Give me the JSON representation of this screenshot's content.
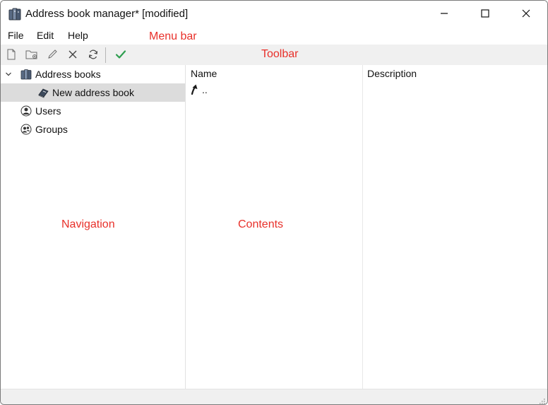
{
  "window": {
    "title": "Address book manager* [modified]",
    "icons": {
      "app": "address-books-icon",
      "minimize": "minimize-icon",
      "maximize": "maximize-icon",
      "close": "close-icon"
    }
  },
  "menubar": {
    "items": [
      {
        "label": "File"
      },
      {
        "label": "Edit"
      },
      {
        "label": "Help"
      }
    ]
  },
  "toolbar": {
    "buttons": [
      {
        "icon": "new-file-icon"
      },
      {
        "icon": "new-folder-icon"
      },
      {
        "icon": "edit-pencil-icon"
      },
      {
        "icon": "delete-x-icon"
      },
      {
        "icon": "refresh-icon"
      },
      {
        "icon": "apply-check-icon",
        "color": "#2e9e4f"
      }
    ]
  },
  "overlays": {
    "menubar": "Menu bar",
    "toolbar": "Toolbar",
    "navigation": "Navigation",
    "contents": "Contents"
  },
  "navigation": {
    "tree": [
      {
        "label": "Address books",
        "icon": "address-books-icon",
        "expanded": true
      },
      {
        "label": "New address book",
        "icon": "address-book-icon",
        "selected": true
      },
      {
        "label": "Users",
        "icon": "user-icon"
      },
      {
        "label": "Groups",
        "icon": "group-icon"
      }
    ]
  },
  "contents": {
    "columns": [
      "Name",
      "Description"
    ],
    "rows": [
      {
        "name": "..",
        "icon": "up-arrow-icon"
      }
    ]
  },
  "colors": {
    "overlay_text": "#e8302a",
    "selection": "#dcdcdc",
    "toolbar_bg": "#f0f0f0",
    "check_green": "#2e9e4f"
  }
}
